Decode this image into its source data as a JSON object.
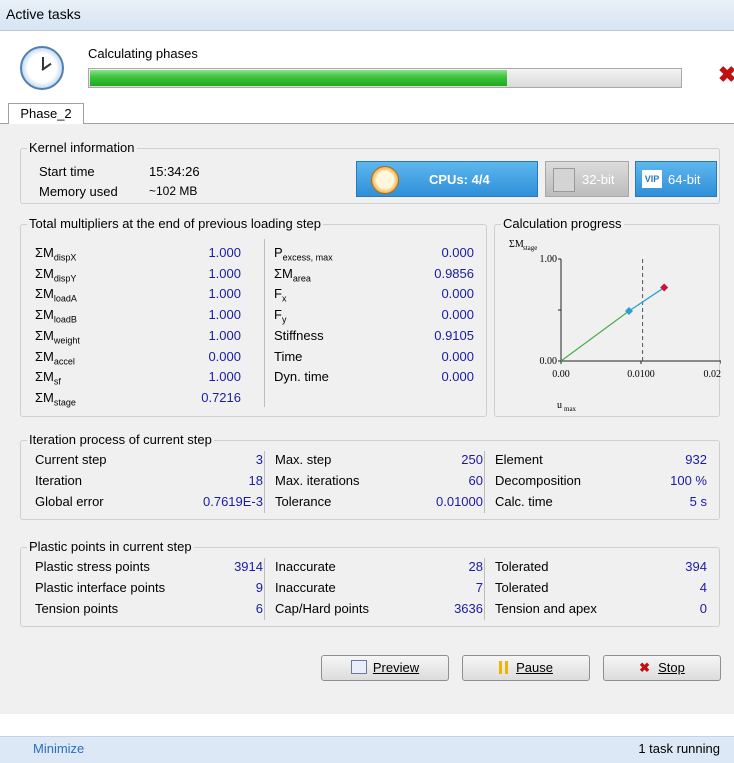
{
  "window": {
    "title": "Active tasks"
  },
  "task": {
    "label": "Calculating phases",
    "progress": 0.705
  },
  "tabs": [
    {
      "label": "Phase_2"
    }
  ],
  "kernel": {
    "legend": "Kernel information",
    "start_time_label": "Start time",
    "start_time": "15:34:26",
    "memory_label": "Memory used",
    "memory": "~102 MB",
    "cpus": "CPUs: 4/4",
    "bit32": "32-bit",
    "bit64": "64-bit",
    "vip": "VIP"
  },
  "multipliers": {
    "legend": "Total multipliers at the end of previous loading step",
    "left": [
      {
        "name": "ΣM",
        "sub": "dispX",
        "value": "1.000"
      },
      {
        "name": "ΣM",
        "sub": "dispY",
        "value": "1.000"
      },
      {
        "name": "ΣM",
        "sub": "loadA",
        "value": "1.000"
      },
      {
        "name": "ΣM",
        "sub": "loadB",
        "value": "1.000"
      },
      {
        "name": "ΣM",
        "sub": "weight",
        "value": "1.000"
      },
      {
        "name": "ΣM",
        "sub": "accel",
        "value": "0.000"
      },
      {
        "name": "ΣM",
        "sub": "sf",
        "value": "1.000"
      },
      {
        "name": "ΣM",
        "sub": "stage",
        "value": "0.7216"
      }
    ],
    "right": [
      {
        "name": "P",
        "sub": "excess, max",
        "value": "0.000"
      },
      {
        "name": "ΣM",
        "sub": "area",
        "value": "0.9856"
      },
      {
        "name": "F",
        "sub": "x",
        "value": "0.000"
      },
      {
        "name": "F",
        "sub": "y",
        "value": "0.000"
      },
      {
        "name": "Stiffness",
        "sub": "",
        "value": "0.9105"
      },
      {
        "name": "Time",
        "sub": "",
        "value": "0.000"
      },
      {
        "name": "Dyn. time",
        "sub": "",
        "value": "0.000"
      }
    ]
  },
  "calc_progress": {
    "legend": "Calculation progress",
    "ylabel": "ΣM",
    "ylabel_sub": "stage",
    "xlabel": "u",
    "xlabel_sub": "max",
    "y_ticks": [
      "1.00",
      "0.00"
    ],
    "x_ticks": [
      "0.00",
      "0.0100",
      "0.02"
    ],
    "colors": {
      "line1": "#4caf50",
      "line2": "#2a9fd6",
      "point1": "#2a9fd6",
      "point2": "#d0103a"
    }
  },
  "chart_data": {
    "type": "line",
    "title": "",
    "xlabel": "u_max",
    "ylabel": "ΣM_stage",
    "xlim": [
      0,
      0.02
    ],
    "ylim": [
      0,
      1
    ],
    "series": [
      {
        "x": [
          0,
          0.0085
        ],
        "y": [
          0,
          0.49
        ]
      },
      {
        "x": [
          0.0085,
          0.0129
        ],
        "y": [
          0.49,
          0.72
        ]
      }
    ],
    "points": [
      {
        "x": 0.0085,
        "y": 0.49
      },
      {
        "x": 0.0129,
        "y": 0.72
      }
    ],
    "reference_x": 0.0102
  },
  "iteration": {
    "legend": "Iteration process of current step",
    "cols": [
      [
        {
          "label": "Current step",
          "value": "3"
        },
        {
          "label": "Iteration",
          "value": "18"
        },
        {
          "label": "Global error",
          "value": "0.7619E-3"
        }
      ],
      [
        {
          "label": "Max. step",
          "value": "250"
        },
        {
          "label": "Max. iterations",
          "value": "60"
        },
        {
          "label": "Tolerance",
          "value": "0.01000"
        }
      ],
      [
        {
          "label": "Element",
          "value": "932"
        },
        {
          "label": "Decomposition",
          "value": "100 %"
        },
        {
          "label": "Calc. time",
          "value": "5 s"
        }
      ]
    ]
  },
  "plastic": {
    "legend": "Plastic points in current step",
    "cols": [
      [
        {
          "label": "Plastic stress points",
          "value": "3914"
        },
        {
          "label": "Plastic interface points",
          "value": "9"
        },
        {
          "label": "Tension points",
          "value": "6"
        }
      ],
      [
        {
          "label": "Inaccurate",
          "value": "28"
        },
        {
          "label": "Inaccurate",
          "value": "7"
        },
        {
          "label": "Cap/Hard points",
          "value": "3636"
        }
      ],
      [
        {
          "label": "Tolerated",
          "value": "394"
        },
        {
          "label": "Tolerated",
          "value": "4"
        },
        {
          "label": "Tension and apex",
          "value": "0"
        }
      ]
    ]
  },
  "buttons": {
    "preview": "Preview",
    "pause": "Pause",
    "stop": "Stop"
  },
  "status": {
    "minimize": "Minimize",
    "running": "1 task running"
  }
}
